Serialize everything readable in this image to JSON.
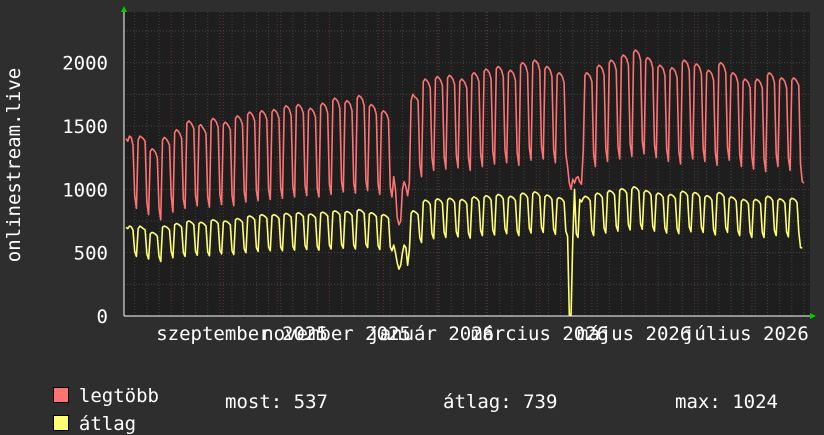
{
  "chart_data": {
    "type": "line",
    "ylabel": "onlinestream.live",
    "ylim": [
      0,
      2400
    ],
    "yticks": [
      0,
      500,
      1000,
      1500,
      2000
    ],
    "xticks": [
      "szeptember 2025",
      "november 2025",
      "január 2026",
      "március 2026",
      "május 2026",
      "július 2026"
    ],
    "grid": true,
    "colors": {
      "background": "#2e2e2e",
      "plot": "#1e1e1e",
      "grid": "#444444",
      "max_series": "#ff7373",
      "avg_series": "#ffff73",
      "axis_arrow": "#00cc00"
    },
    "x_start": "2025-08-06",
    "series": [
      {
        "name": "legtöbb",
        "color": "#ff7373",
        "step_days": 1,
        "values": [
          1400,
          1380,
          1420,
          1410,
          1350,
          950,
          850,
          1390,
          1420,
          1410,
          1400,
          1380,
          900,
          800,
          1300,
          1320,
          1310,
          1290,
          1250,
          850,
          760,
          1390,
          1410,
          1400,
          1380,
          1350,
          950,
          820,
          1450,
          1470,
          1460,
          1440,
          1400,
          920,
          850,
          1520,
          1540,
          1530,
          1510,
          1480,
          950,
          870,
          1500,
          1510,
          1490,
          1470,
          1440,
          940,
          860,
          1540,
          1560,
          1550,
          1530,
          1490,
          960,
          880,
          1510,
          1530,
          1520,
          1500,
          1470,
          950,
          870,
          1560,
          1580,
          1570,
          1550,
          1510,
          980,
          900,
          1590,
          1610,
          1600,
          1580,
          1540,
          990,
          910,
          1600,
          1620,
          1610,
          1590,
          1550,
          1000,
          920,
          1610,
          1630,
          1620,
          1600,
          1560,
          1010,
          930,
          1640,
          1660,
          1650,
          1630,
          1580,
          1020,
          940,
          1650,
          1670,
          1660,
          1640,
          1600,
          1030,
          950,
          1620,
          1640,
          1630,
          1610,
          1570,
          1010,
          940,
          1660,
          1680,
          1670,
          1650,
          1600,
          1040,
          960,
          1700,
          1720,
          1710,
          1690,
          1640,
          1060,
          980,
          1680,
          1700,
          1690,
          1670,
          1620,
          1050,
          970,
          1720,
          1740,
          1730,
          1710,
          1660,
          1070,
          990,
          1650,
          1670,
          1660,
          1640,
          1590,
          1040,
          960,
          1600,
          1620,
          1610,
          1590,
          1550,
          1020,
          940,
          1100,
          1000,
          780,
          720,
          750,
          1000,
          1060,
          1020,
          950,
          1050,
          1700,
          1750,
          1730,
          1720,
          1700,
          1200,
          1100,
          1850,
          1870,
          1860,
          1840,
          1800,
          1250,
          1150,
          1870,
          1890,
          1880,
          1860,
          1820,
          1260,
          1160,
          1880,
          1900,
          1890,
          1870,
          1830,
          1270,
          1170,
          1850,
          1870,
          1860,
          1840,
          1800,
          1250,
          1150,
          1900,
          1920,
          1910,
          1890,
          1850,
          1280,
          1180,
          1930,
          1950,
          1940,
          1920,
          1870,
          1300,
          1200,
          1950,
          1970,
          1960,
          1940,
          1890,
          1310,
          1210,
          1920,
          1940,
          1930,
          1910,
          1860,
          1290,
          1190,
          1980,
          2000,
          1990,
          1970,
          1920,
          1330,
          1230,
          2000,
          2020,
          2010,
          1990,
          1940,
          1340,
          1240,
          1950,
          1970,
          1960,
          1940,
          1890,
          1310,
          1210,
          1900,
          1920,
          1910,
          1890,
          1840,
          1280,
          1180,
          1050,
          1000,
          1080,
          1050,
          1090,
          1100,
          1060,
          1040,
          1300,
          1900,
          1920,
          1910,
          1890,
          1850,
          1280,
          1180,
          1960,
          1980,
          1970,
          1950,
          1900,
          1320,
          1220,
          2000,
          2020,
          2010,
          1990,
          1940,
          1340,
          1240,
          2040,
          2060,
          2050,
          2030,
          1980,
          1360,
          1260,
          2080,
          2100,
          2090,
          2070,
          2020,
          1380,
          1280,
          2020,
          2040,
          2030,
          2010,
          1960,
          1350,
          1250,
          1960,
          1980,
          1970,
          1950,
          1900,
          1320,
          1220,
          1940,
          1960,
          1950,
          1930,
          1880,
          1300,
          1200,
          2000,
          2020,
          2010,
          1990,
          1940,
          1340,
          1240,
          1970,
          1990,
          1980,
          1960,
          1910,
          1320,
          1220,
          1920,
          1940,
          1930,
          1910,
          1860,
          1290,
          1190,
          1980,
          2000,
          1990,
          1970,
          1920,
          1330,
          1230,
          1900,
          1920,
          1910,
          1890,
          1840,
          1280,
          1180,
          1850,
          1870,
          1860,
          1840,
          1800,
          1260,
          1160,
          1850,
          1870,
          1860,
          1840,
          1800,
          1240,
          1140,
          1900,
          1920,
          1910,
          1890,
          1840,
          1280,
          1180,
          1860,
          1880,
          1870,
          1850,
          1800,
          1250,
          1150,
          1860,
          1880,
          1870,
          1850,
          1820,
          1200,
          1060,
          1050
        ]
      },
      {
        "name": "átlag",
        "color": "#ffff73",
        "step_days": 1,
        "values": [
          700,
          690,
          710,
          705,
          680,
          510,
          470,
          690,
          710,
          700,
          690,
          680,
          490,
          450,
          650,
          660,
          655,
          645,
          630,
          470,
          430,
          700,
          710,
          705,
          695,
          680,
          510,
          460,
          720,
          730,
          725,
          715,
          700,
          500,
          470,
          740,
          750,
          745,
          735,
          720,
          510,
          480,
          730,
          740,
          735,
          725,
          710,
          505,
          475,
          750,
          760,
          755,
          745,
          730,
          520,
          490,
          740,
          750,
          745,
          735,
          720,
          515,
          485,
          760,
          770,
          765,
          755,
          740,
          530,
          500,
          780,
          790,
          785,
          775,
          760,
          540,
          510,
          790,
          800,
          795,
          785,
          770,
          545,
          515,
          790,
          800,
          795,
          785,
          770,
          545,
          515,
          800,
          810,
          805,
          795,
          780,
          550,
          520,
          805,
          815,
          810,
          800,
          785,
          555,
          525,
          795,
          805,
          800,
          790,
          775,
          550,
          520,
          810,
          820,
          815,
          805,
          790,
          560,
          530,
          820,
          830,
          825,
          815,
          800,
          565,
          535,
          815,
          825,
          820,
          810,
          795,
          560,
          530,
          830,
          840,
          835,
          825,
          810,
          570,
          540,
          805,
          815,
          810,
          800,
          785,
          555,
          525,
          790,
          800,
          795,
          785,
          770,
          545,
          515,
          560,
          500,
          420,
          370,
          400,
          500,
          560,
          540,
          400,
          520,
          810,
          830,
          825,
          815,
          800,
          620,
          580,
          900,
          915,
          910,
          900,
          880,
          650,
          610,
          910,
          925,
          920,
          910,
          890,
          660,
          620,
          915,
          930,
          925,
          915,
          895,
          665,
          625,
          905,
          920,
          915,
          905,
          885,
          655,
          615,
          925,
          940,
          935,
          925,
          905,
          675,
          635,
          935,
          950,
          945,
          935,
          915,
          680,
          640,
          945,
          960,
          955,
          945,
          925,
          690,
          650,
          930,
          945,
          940,
          930,
          910,
          675,
          635,
          955,
          970,
          965,
          955,
          935,
          695,
          655,
          965,
          980,
          975,
          965,
          945,
          700,
          660,
          940,
          955,
          950,
          940,
          920,
          685,
          645,
          920,
          935,
          930,
          920,
          900,
          670,
          630,
          10,
          10,
          600,
          1000,
          650,
          620,
          920,
          900,
          930,
          945,
          940,
          930,
          910,
          675,
          635,
          955,
          970,
          965,
          955,
          935,
          695,
          655,
          975,
          990,
          985,
          975,
          955,
          710,
          670,
          990,
          1005,
          1000,
          990,
          970,
          720,
          680,
          1000,
          1020,
          1015,
          1005,
          985,
          725,
          685,
          975,
          990,
          985,
          975,
          955,
          710,
          670,
          955,
          970,
          965,
          955,
          935,
          695,
          655,
          945,
          960,
          955,
          945,
          925,
          690,
          650,
          970,
          985,
          980,
          970,
          950,
          705,
          665,
          960,
          975,
          970,
          960,
          940,
          700,
          660,
          935,
          950,
          945,
          935,
          915,
          680,
          640,
          960,
          975,
          970,
          960,
          940,
          700,
          660,
          925,
          940,
          935,
          925,
          905,
          675,
          635,
          905,
          920,
          915,
          905,
          885,
          660,
          620,
          905,
          920,
          915,
          905,
          885,
          660,
          620,
          930,
          945,
          940,
          930,
          910,
          675,
          635,
          910,
          925,
          920,
          910,
          890,
          665,
          625,
          915,
          930,
          925,
          915,
          895,
          665,
          540,
          537
        ]
      }
    ]
  },
  "legend": {
    "max_label": "legtöbb",
    "avg_label": "átlag",
    "now_text": "most: 537",
    "avg_text": "átlag: 739",
    "max_text": "max: 1024"
  }
}
